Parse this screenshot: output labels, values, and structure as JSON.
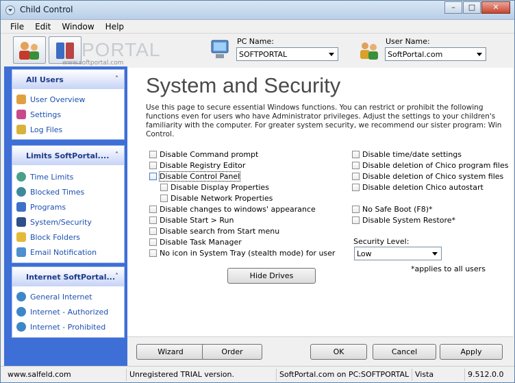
{
  "window": {
    "title": "Child Control"
  },
  "menu": [
    "File",
    "Edit",
    "Window",
    "Help"
  ],
  "toolbar": {
    "logo_text": "PORTAL",
    "logo_url": "www.softportal.com",
    "pc_label": "PC Name:",
    "pc_value": "SOFTPORTAL",
    "user_label": "User Name:",
    "user_value": "SoftPortal.com"
  },
  "sidebar": {
    "panel1": {
      "title": "All Users",
      "items": [
        "User Overview",
        "Settings",
        "Log Files"
      ]
    },
    "panel2": {
      "title": "Limits SoftPortal....",
      "items": [
        "Time Limits",
        "Blocked Times",
        "Programs",
        "System/Security",
        "Block Folders",
        "Email Notification"
      ]
    },
    "panel3": {
      "title": "Internet SoftPortal...",
      "items": [
        "General Internet",
        "Internet - Authorized",
        "Internet - Prohibited"
      ]
    }
  },
  "main": {
    "heading": "System and Security",
    "description": "Use this page to secure essential Windows functions. You can restrict or prohibit the following functions even for users who have Administrator privileges. Adjust the settings to your children's familiarity with the computer. For greater system security, we recommend our sister program: Win Control.",
    "left_options": [
      "Disable Command prompt",
      "Disable Registry Editor",
      "Disable Control Panel",
      "Disable Display Properties",
      "Disable Network Properties",
      "Disable changes to windows' appearance",
      "Disable Start > Run",
      "Disable search from Start menu",
      "Disable Task Manager",
      "No icon in System Tray (stealth mode) for user"
    ],
    "right_options": [
      "Disable time/date settings",
      "Disable deletion of Chico program files",
      "Disable deletion of Chico system files",
      "Disable deletion Chico autostart",
      "No Safe Boot (F8)*",
      "Disable System Restore*"
    ],
    "security_level_label": "Security Level:",
    "security_level_value": "Low",
    "applies_note": "*applies to all users",
    "hide_drives": "Hide Drives"
  },
  "buttons": {
    "wizard": "Wizard",
    "order": "Order",
    "ok": "OK",
    "cancel": "Cancel",
    "apply": "Apply"
  },
  "status": {
    "site": "www.salfeld.com",
    "trial": "Unregistered TRIAL version.",
    "host": "SoftPortal.com on PC:SOFTPORTAL",
    "os": "Vista",
    "version": "9.512.0.0"
  }
}
